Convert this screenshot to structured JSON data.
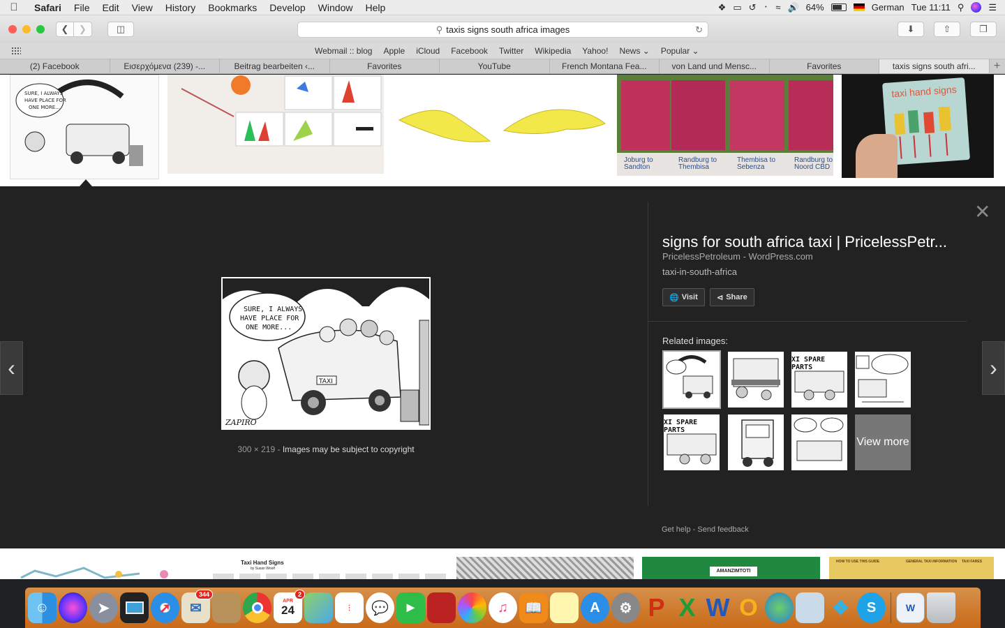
{
  "menubar": {
    "app": "Safari",
    "items": [
      "File",
      "Edit",
      "View",
      "History",
      "Bookmarks",
      "Develop",
      "Window",
      "Help"
    ],
    "battery": "64%",
    "input_lang": "German",
    "clock": "Tue 11:11"
  },
  "toolbar": {
    "address": "taxis signs south africa images"
  },
  "favorites": [
    "Webmail :: blog",
    "Apple",
    "iCloud",
    "Facebook",
    "Twitter",
    "Wikipedia",
    "Yahoo!",
    "News ⌄",
    "Popular ⌄"
  ],
  "tabs": [
    {
      "label": "(2) Facebook"
    },
    {
      "label": "Εισερχόμενα (239) -..."
    },
    {
      "label": "Beitrag bearbeiten ‹..."
    },
    {
      "label": "Favorites"
    },
    {
      "label": "YouTube"
    },
    {
      "label": "French Montana Fea..."
    },
    {
      "label": "von Land und Mensc..."
    },
    {
      "label": "Favorites"
    },
    {
      "label": "taxis signs south afri..."
    }
  ],
  "top_strip": {
    "taxi_routes": [
      {
        "label": "Joburg to\nSandton"
      },
      {
        "label": "Randburg to\nThembisa"
      },
      {
        "label": "Thembisa to\nSebenza"
      },
      {
        "label": "Randburg to\nNoord CBD"
      }
    ],
    "hand_signs_title": "taxi hand signs"
  },
  "preview": {
    "cartoon_text": "SURE, I ALWAYS HAVE PLACE FOR ONE MORE...",
    "cartoon_taxi": "TAXI",
    "cartoon_signature": "ZAPIRO",
    "dimensions": "300 × 219",
    "copyright": "Images may be subject to copyright",
    "title": "signs for south africa taxi | PricelessPetr...",
    "source": "PricelessPetroleum - WordPress.com",
    "description": "taxi-in-south-africa",
    "visit": "Visit",
    "share": "Share",
    "related_title": "Related images:",
    "view_more": "View more",
    "help": "Get help",
    "feedback": "Send feedback",
    "rel_spare_parts": "XI SPARE PARTS"
  },
  "bottom_strip": {
    "hand_signs_title": "Taxi Hand Signs",
    "hand_signs_author": "by Susan Woolf",
    "amanzimtoti": "AMANZIMTOTI",
    "guide_cols": [
      "HOW TO USE THIS GUIDE",
      "GENERAL TAXI INFORMATION",
      "TAXI FARES"
    ]
  },
  "dock": {
    "mail_badge": "344",
    "calendar_month": "APR",
    "calendar_day": "24",
    "calendar_badge": "2"
  }
}
